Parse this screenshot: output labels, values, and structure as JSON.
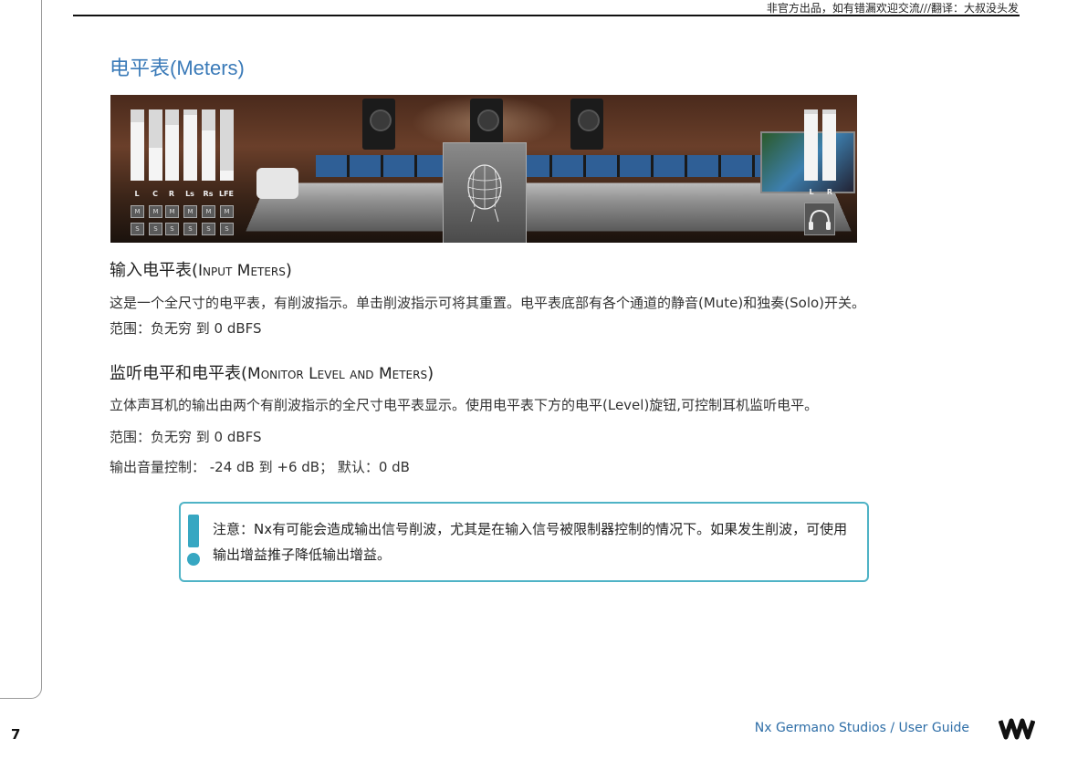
{
  "header": {
    "note": "非官方出品，如有错漏欢迎交流///翻译：大叔没头发"
  },
  "section": {
    "title": "电平表(Meters)"
  },
  "hero": {
    "input_meters": [
      {
        "label": "L",
        "level": 0.82
      },
      {
        "label": "C",
        "level": 0.46
      },
      {
        "label": "R",
        "level": 0.78
      },
      {
        "label": "Ls",
        "level": 0.92
      },
      {
        "label": "Rs",
        "level": 0.7
      },
      {
        "label": "LFE",
        "level": 0.14
      }
    ],
    "mute_label": "M",
    "solo_label": "S",
    "output_meters": [
      {
        "label": "L",
        "level": 0.94
      },
      {
        "label": "R",
        "level": 0.94
      }
    ],
    "headphone_icon": "headphones-icon"
  },
  "input_meters": {
    "heading_cn": "输入电平表(",
    "heading_en": "Input Meters",
    "heading_end": ")",
    "desc": "这是一个全尺寸的电平表，有削波指示。单击削波指示可将其重置。电平表底部有各个通道的静音(Mute)和独奏(Solo)开关。",
    "range": "范围：负无穷 到 0 dBFS"
  },
  "monitor": {
    "heading_cn": "监听电平和电平表(",
    "heading_en": "Monitor Level and Meters",
    "heading_end": ")",
    "desc": "立体声耳机的输出由两个有削波指示的全尺寸电平表显示。使用电平表下方的电平(Level)旋钮,可控制耳机监听电平。",
    "range": "范围：负无穷 到 0 dBFS",
    "control": "输出音量控制： -24 dB 到 +6 dB； 默认：0  dB"
  },
  "note": {
    "icon": "exclamation-icon",
    "text": "注意：Nx有可能会造成输出信号削波，尤其是在输入信号被限制器控制的情况下。如果发生削波，可使用输出增益推子降低输出增益。"
  },
  "footer": {
    "page_number": "7",
    "title": "Nx Germano Studios / User Guide",
    "logo": "waves-logo-icon"
  },
  "colors": {
    "accent": "#3a7ab8",
    "note_border": "#4fb3c6"
  }
}
